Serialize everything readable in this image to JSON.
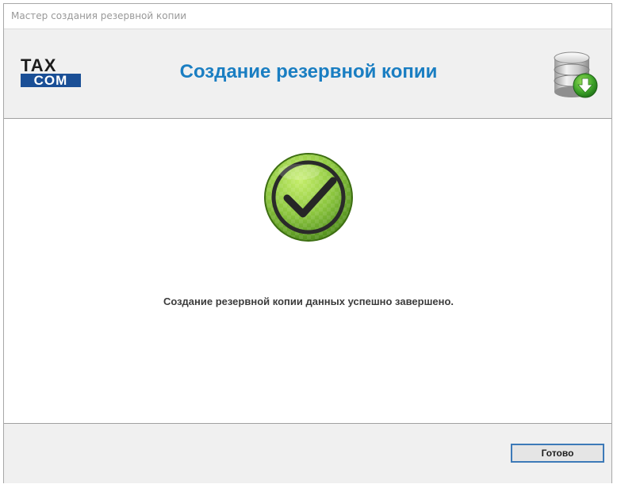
{
  "window": {
    "title": "Мастер создания резервной копии"
  },
  "header": {
    "logo": {
      "top_text": "TAX",
      "bottom_text": "COM"
    },
    "title": "Создание резервной копии",
    "icon": "database-download-icon"
  },
  "content": {
    "icon": "success-check-icon",
    "message": "Создание резервной копии данных успешно завершено."
  },
  "footer": {
    "done_label": "Готово"
  },
  "colors": {
    "title_blue": "#1a7ec2",
    "logo_blue": "#1a4f96",
    "success_green": "#8cc63f",
    "button_border": "#3d7ab8"
  }
}
